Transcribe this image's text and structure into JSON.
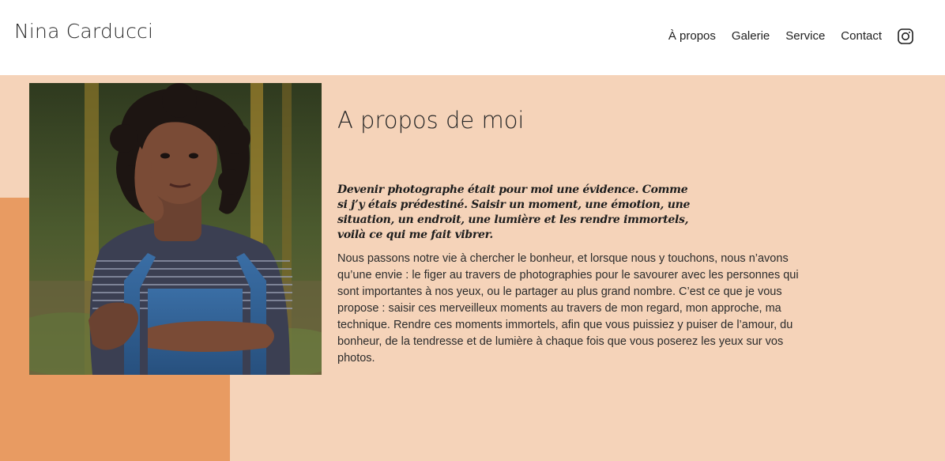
{
  "header": {
    "brand": "Nina Carducci",
    "nav": [
      {
        "label": "À propos"
      },
      {
        "label": "Galerie"
      },
      {
        "label": "Service"
      },
      {
        "label": "Contact"
      }
    ],
    "instagram_icon": "instagram-icon"
  },
  "about": {
    "title": "A propos de moi",
    "quote": "Devenir photographe était pour moi une évidence. Comme si j’y étais prédestiné. Saisir un moment, une émotion, une situation, un endroit, une lumière et les rendre immortels, voilà ce qui me fait vibrer.",
    "body": "Nous passons notre vie à chercher le bonheur, et lorsque nous y touchons, nous n’avons qu’une envie : le figer au travers de photographies pour le savourer avec les personnes qui sont importantes à nos yeux, ou le partager au plus grand nombre. C’est ce que je vous propose : saisir ces merveilleux moments au travers de mon regard, mon approche, ma technique. Rendre ces moments immortels, afin que vous puissiez y puiser de l’amour, du bonheur, de la tendresse et de lumière à chaque fois que vous poserez les yeux sur vos photos."
  },
  "colors": {
    "section_bg": "#f5d3b9",
    "accent": "#e89b62",
    "text": "#1f1f1f"
  }
}
